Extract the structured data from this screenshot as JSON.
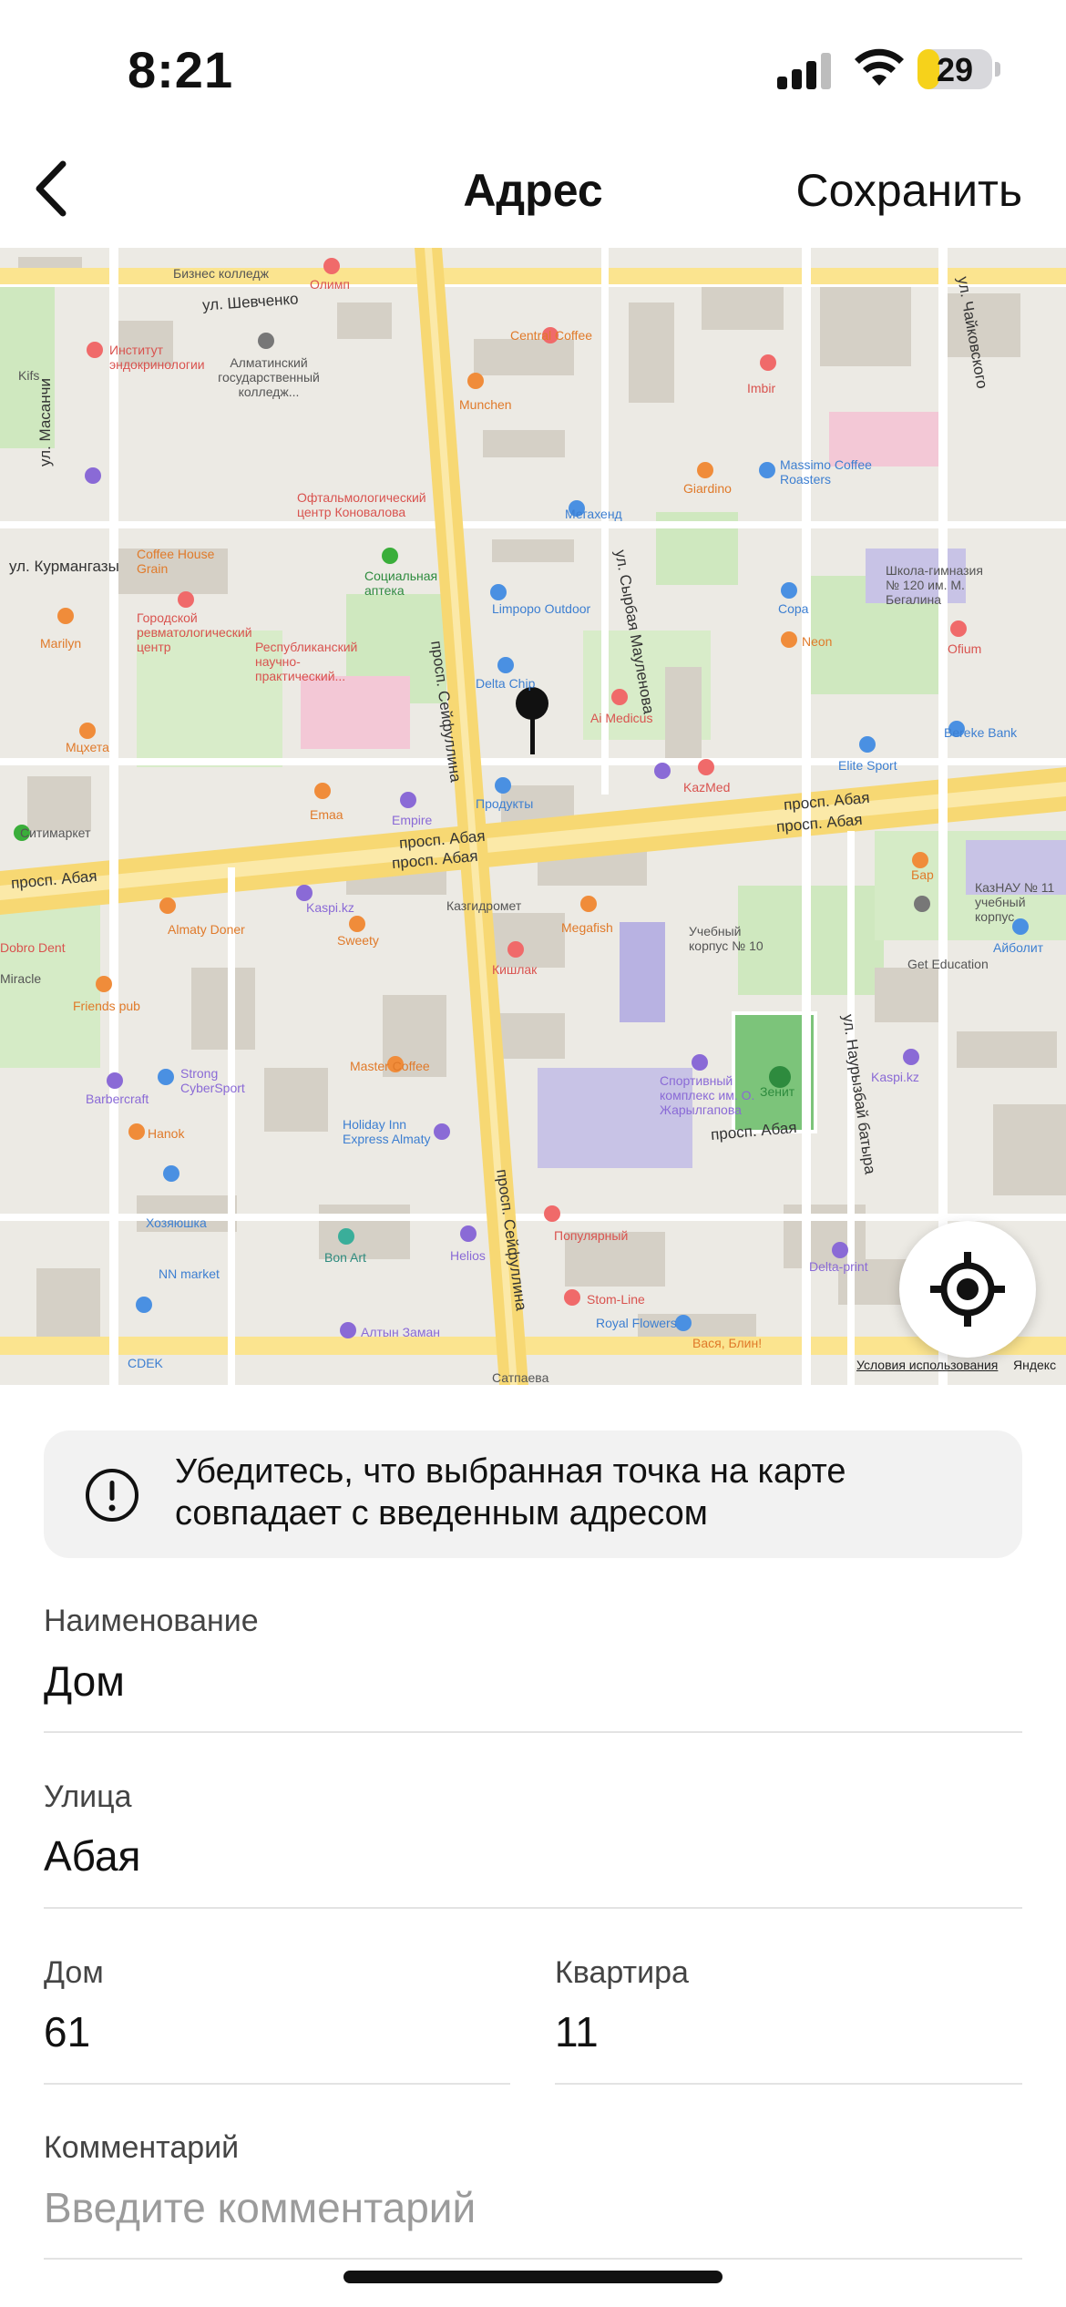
{
  "status_bar": {
    "time": "8:21",
    "battery_level": "29",
    "battery_fraction": 0.29
  },
  "nav": {
    "title": "Адрес",
    "save_label": "Сохранить",
    "back_icon": "chevron-left-icon"
  },
  "map": {
    "pin_icon": "map-pin-icon",
    "locate_icon": "crosshair-locate-icon",
    "terms": "Условия использования",
    "brand": "Яндекс",
    "labels": {
      "shevchenko": "ул. Шевченко",
      "abaya1": "просп. Абая",
      "abaya2": "просп. Абая",
      "abaya3": "просп. Абая",
      "abaya4": "просп. Абая",
      "abaya5": "просп. Абая",
      "abaya6": "просп. Абая",
      "seifullina1": "просп. Сейфуллина",
      "seifullina2": "просп. Сейфуллина",
      "kurmangazy": "ул. Курмангазы",
      "maulenova": "ул. Сырбая Маулен​ова",
      "masanchi": "ул. Масанчи",
      "chaikovskogo": "ул. Чайковского",
      "naurizbai": "ул. Наурызбай батыра",
      "central_coffee": "Central Coffee",
      "munchen": "Munchen",
      "imbir": "Imbir",
      "giardino": "Giardino",
      "massimo": "Massimo Coffee Roasters",
      "megazhend": "Мегахенд",
      "limpopo": "Limpopo Outdoor",
      "sora": "Сора",
      "neon": "Neon",
      "delta_chip": "Delta Chip",
      "ai_medicus": "Ai Medicus",
      "produkty": "Продукты",
      "kazmed": "KazMed",
      "elite_sport": "Elite Sport",
      "bereke": "Bereke Bank",
      "ofium": "Ofium",
      "school": "Школа-гимназия № 120 им. М. Бегалина",
      "olimp": "Олимп",
      "biznes": "Бизнес колледж",
      "institute": "Институт эндокринологии",
      "almaty_college": "Алматинский государственный колледж...",
      "coffee_house": "Coffee House Grain",
      "social_pharmacy": "Социальная аптека",
      "ophthalm": "Офтальмологический центр Коновалова",
      "rheum": "Городской ревматологический центр",
      "republic_center": "Республиканский научно-практический...",
      "marilyn": "Marilyn",
      "myxeta": "Мцхета",
      "emaa": "Emaa",
      "empire": "Empire",
      "sitimarket": "Ситимаркет",
      "almaty_doner": "Almaty Doner",
      "kaspi1": "Kaspi.kz",
      "kazgidromet": "Казгидромет",
      "sweety": "Sweety",
      "megafish": "Megafish",
      "kishlak": "Кишлак",
      "uchebny": "Учебный корпус № 10",
      "kaznau": "КазНАУ № 11 учебный корпус",
      "aibolit": "Айболит",
      "get_education": "Get Education",
      "bar": "Бар",
      "friends_pub": "Friends pub",
      "barbercraft": "Barbercraft",
      "strong": "Strong CyberSport",
      "hanok": "Hanok",
      "master_coffee": "Master Coffee",
      "holiday_inn": "Holiday Inn Express Almaty",
      "sport_complex": "Спортивный комплекс им. О. Жарылгапова",
      "zenit": "Зенит",
      "kaspi2": "Kaspi.kz",
      "khozyayushka": "Хозяюшка",
      "nn_market": "NN market",
      "bon_art": "Bon Art",
      "helios": "Helios",
      "populyarny": "Популярный",
      "delta_print": "Delta-print",
      "stom_line": "Stom-Line",
      "royal_flowers": "Royal Flowers",
      "vasya": "Вася, Блин!",
      "altyn_zaman": "Алтын Заман",
      "cdek": "CDEK",
      "satpaeva": "Сатпаева",
      "dobro_dent": "Dobro Dent",
      "miracle": "Miracle",
      "kifs": "Kifs"
    }
  },
  "notice": {
    "icon": "exclamation-circle-icon",
    "text": "Убедитесь, что выбранная точка на карте совпадает с введенным адресом"
  },
  "fields": {
    "name": {
      "label": "Наименование",
      "value": "Дом"
    },
    "street": {
      "label": "Улица",
      "value": "Абая"
    },
    "house": {
      "label": "Дом",
      "value": "61"
    },
    "apartment": {
      "label": "Квартира",
      "value": "11"
    },
    "comment": {
      "label": "Комментарий",
      "value": "",
      "placeholder": "Введите комментарий"
    }
  }
}
